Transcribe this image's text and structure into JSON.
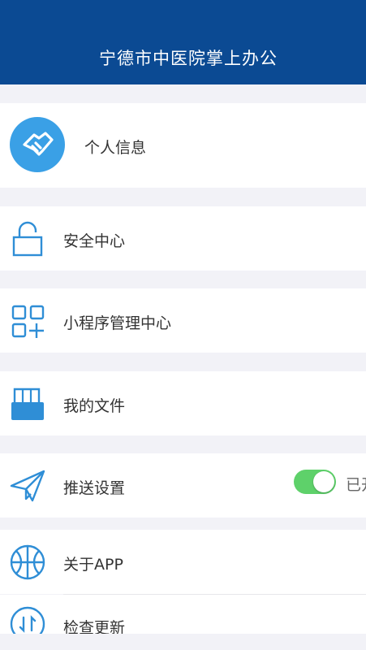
{
  "header": {
    "title": "宁德市中医院掌上办公"
  },
  "menu": {
    "profile": {
      "label": "个人信息",
      "icon": "handshake-icon"
    },
    "security": {
      "label": "安全中心",
      "icon": "unlock-icon"
    },
    "mini_programs": {
      "label": "小程序管理中心",
      "icon": "grid-add-icon"
    },
    "files": {
      "label": "我的文件",
      "icon": "folder-icon"
    },
    "push": {
      "label": "推送设置",
      "icon": "paper-plane-icon",
      "toggle_on": true,
      "toggle_text": "已开"
    },
    "about": {
      "label": "关于APP",
      "icon": "basketball-icon"
    },
    "update": {
      "label": "检查更新",
      "icon": "update-icon"
    }
  },
  "colors": {
    "header": "#0b4a93",
    "icon_blue": "#2f8ed6",
    "toggle_on": "#5ed16a"
  }
}
